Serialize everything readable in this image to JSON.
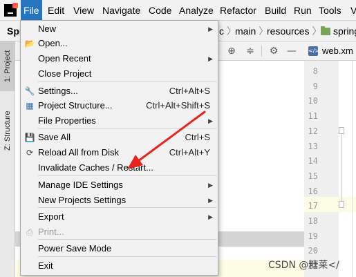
{
  "menubar": {
    "items": [
      "File",
      "Edit",
      "View",
      "Navigate",
      "Code",
      "Analyze",
      "Refactor",
      "Build",
      "Run",
      "Tools",
      "V"
    ],
    "active": "File"
  },
  "navbar": {
    "left_fragment": "Spr",
    "crumbs": [
      "c",
      "main",
      "resources",
      "spring"
    ]
  },
  "tool_tabs": {
    "project": "1: Project",
    "structure": "Z: Structure"
  },
  "editor": {
    "tab_label": "web.xm",
    "line_numbers": [
      "8",
      "9",
      "10",
      "11",
      "12",
      "13",
      "14",
      "15",
      "16",
      "17",
      "18",
      "19",
      "20",
      "21"
    ]
  },
  "file_menu": {
    "items": [
      {
        "label": "New",
        "shortcut": "",
        "submenu": true,
        "icon": "",
        "disabled": false
      },
      {
        "label": "Open...",
        "shortcut": "",
        "submenu": false,
        "icon": "folder-open-icon",
        "disabled": false
      },
      {
        "label": "Open Recent",
        "shortcut": "",
        "submenu": true,
        "icon": "",
        "disabled": false
      },
      {
        "label": "Close Project",
        "shortcut": "",
        "submenu": false,
        "icon": "",
        "disabled": false
      },
      {
        "label": "Settings...",
        "shortcut": "Ctrl+Alt+S",
        "submenu": false,
        "icon": "wrench-icon",
        "disabled": false
      },
      {
        "label": "Project Structure...",
        "shortcut": "Ctrl+Alt+Shift+S",
        "submenu": false,
        "icon": "project-structure-icon",
        "disabled": false
      },
      {
        "label": "File Properties",
        "shortcut": "",
        "submenu": true,
        "icon": "",
        "disabled": false
      },
      {
        "label": "Save All",
        "shortcut": "Ctrl+S",
        "submenu": false,
        "icon": "save-icon",
        "disabled": false
      },
      {
        "label": "Reload All from Disk",
        "shortcut": "Ctrl+Alt+Y",
        "submenu": false,
        "icon": "reload-icon",
        "disabled": false
      },
      {
        "label": "Invalidate Caches / Restart...",
        "shortcut": "",
        "submenu": false,
        "icon": "",
        "disabled": false
      },
      {
        "label": "Manage IDE Settings",
        "shortcut": "",
        "submenu": true,
        "icon": "",
        "disabled": false
      },
      {
        "label": "New Projects Settings",
        "shortcut": "",
        "submenu": true,
        "icon": "",
        "disabled": false
      },
      {
        "label": "Export",
        "shortcut": "",
        "submenu": true,
        "icon": "",
        "disabled": false
      },
      {
        "label": "Print...",
        "shortcut": "",
        "submenu": false,
        "icon": "print-icon",
        "disabled": true
      },
      {
        "label": "Power Save Mode",
        "shortcut": "",
        "submenu": false,
        "icon": "",
        "disabled": false
      },
      {
        "label": "Exit",
        "shortcut": "",
        "submenu": false,
        "icon": "",
        "disabled": false
      }
    ]
  },
  "annotation": {
    "arrow_color": "#e8231c",
    "target": "Invalidate Caches / Restart..."
  },
  "watermark": "CSDN @糖莱</",
  "colors": {
    "menu_active": "#2675bf",
    "menu_bg": "#f2f2f2"
  }
}
